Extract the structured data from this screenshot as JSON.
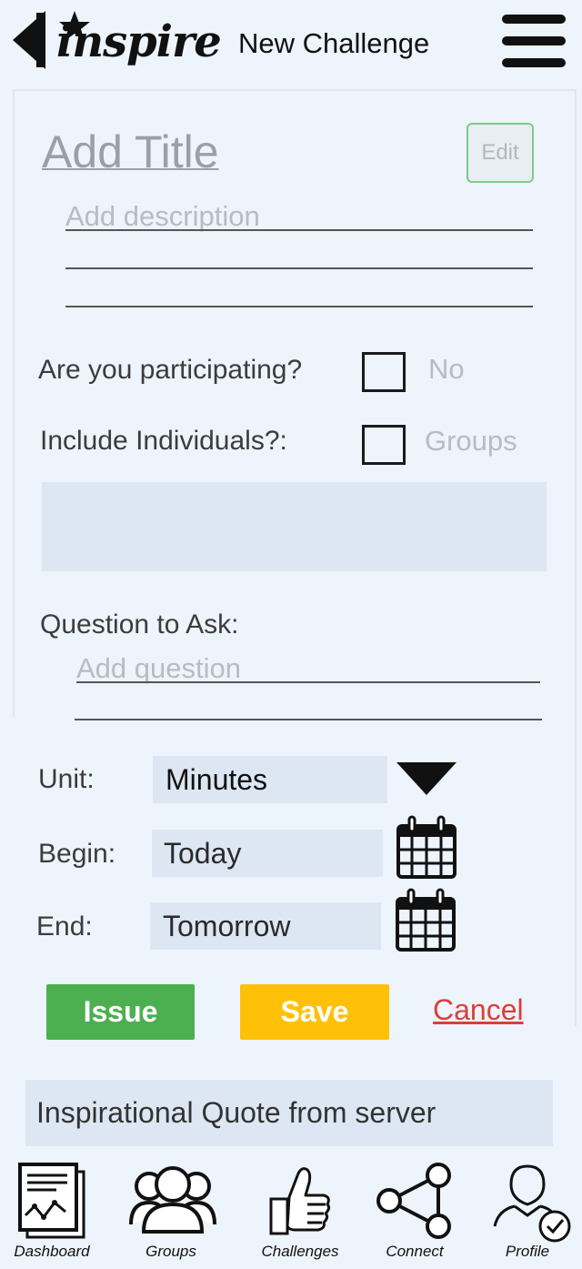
{
  "header": {
    "logo": "inspire",
    "title": "New Challenge",
    "back_icon": "back-arrow-icon",
    "menu_icon": "hamburger-menu-icon"
  },
  "form": {
    "title_placeholder": "Add Title",
    "edit_label": "Edit",
    "description_placeholder": "Add description",
    "participating_label": "Are you participating?",
    "participating_value": "No",
    "include_label": "Include Individuals?:",
    "include_value": "Groups",
    "question_label": "Question to Ask:",
    "question_placeholder": "Add question",
    "unit_label": "Unit:",
    "unit_value": "Minutes",
    "begin_label": "Begin:",
    "begin_value": "Today",
    "end_label": "End:",
    "end_value": "Tomorrow"
  },
  "actions": {
    "issue_label": "Issue",
    "save_label": "Save",
    "cancel_label": "Cancel"
  },
  "quote": "Inspirational Quote from server",
  "nav": {
    "items": [
      {
        "label": "Dashboard",
        "icon": "dashboard-icon"
      },
      {
        "label": "Groups",
        "icon": "groups-icon"
      },
      {
        "label": "Challenges",
        "icon": "thumbs-up-icon"
      },
      {
        "label": "Connect",
        "icon": "share-network-icon"
      },
      {
        "label": "Profile",
        "icon": "profile-check-icon"
      }
    ]
  },
  "colors": {
    "background": "#edf4fc",
    "issue": "#4caf50",
    "save": "#ffc107",
    "cancel": "#d9403a",
    "field": "#dce7f3"
  }
}
